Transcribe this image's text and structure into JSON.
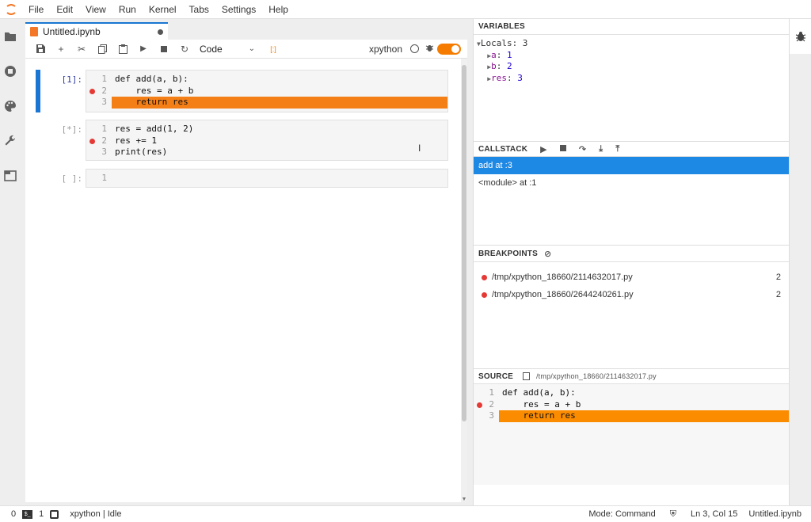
{
  "menu": [
    "File",
    "Edit",
    "View",
    "Run",
    "Kernel",
    "Tabs",
    "Settings",
    "Help"
  ],
  "left_sidebar_icons": [
    "folder-icon",
    "stop-circle-icon",
    "palette-icon",
    "wrench-icon",
    "tab-window-icon"
  ],
  "right_sidebar_icons": [
    "bug-icon"
  ],
  "document_tab": {
    "title": "Untitled.ipynb"
  },
  "toolbar": {
    "cell_type": "Code",
    "kernel": "xpython",
    "run_all_glyph": "[:]"
  },
  "cells": [
    {
      "prompt": "[1]:",
      "selected": true,
      "lines": [
        {
          "no": "1",
          "code": "def add(a, b):",
          "bp": false,
          "hl": false
        },
        {
          "no": "2",
          "code": "    res = a + b",
          "bp": true,
          "hl": false
        },
        {
          "no": "3",
          "code": "    return res",
          "bp": false,
          "hl": true
        }
      ]
    },
    {
      "prompt": "[*]:",
      "selected": false,
      "lines": [
        {
          "no": "1",
          "code": "res = add(1, 2)",
          "bp": false,
          "hl": false
        },
        {
          "no": "2",
          "code": "res += 1",
          "bp": true,
          "hl": false
        },
        {
          "no": "3",
          "code": "print(res)",
          "bp": false,
          "hl": false
        }
      ]
    },
    {
      "prompt": "[ ]:",
      "selected": false,
      "lines": [
        {
          "no": "1",
          "code": "",
          "bp": false,
          "hl": false
        }
      ]
    }
  ],
  "debugger": {
    "variables": {
      "title": "VARIABLES",
      "scope": "Locals: 3",
      "items": [
        {
          "name": "a",
          "value": "1"
        },
        {
          "name": "b",
          "value": "2"
        },
        {
          "name": "res",
          "value": "3"
        }
      ]
    },
    "callstack": {
      "title": "CALLSTACK",
      "frames": [
        "add at :3",
        "<module> at :1"
      ]
    },
    "breakpoints": {
      "title": "BREAKPOINTS",
      "items": [
        {
          "path": "/tmp/xpython_18660/2114632017.py",
          "line": "2"
        },
        {
          "path": "/tmp/xpython_18660/2644240261.py",
          "line": "2"
        }
      ]
    },
    "source": {
      "title": "SOURCE",
      "path": "/tmp/xpython_18660/2114632017.py",
      "lines": [
        {
          "no": "1",
          "code": "def add(a, b):",
          "bp": false,
          "hl": false
        },
        {
          "no": "2",
          "code": "    res = a + b",
          "bp": true,
          "hl": false
        },
        {
          "no": "3",
          "code": "    return res",
          "bp": false,
          "hl": true
        }
      ]
    }
  },
  "status": {
    "terminals": "0",
    "kernels": "1",
    "kernel_state": "xpython | Idle",
    "mode": "Mode: Command",
    "position": "Ln 3, Col 15",
    "file": "Untitled.ipynb"
  }
}
